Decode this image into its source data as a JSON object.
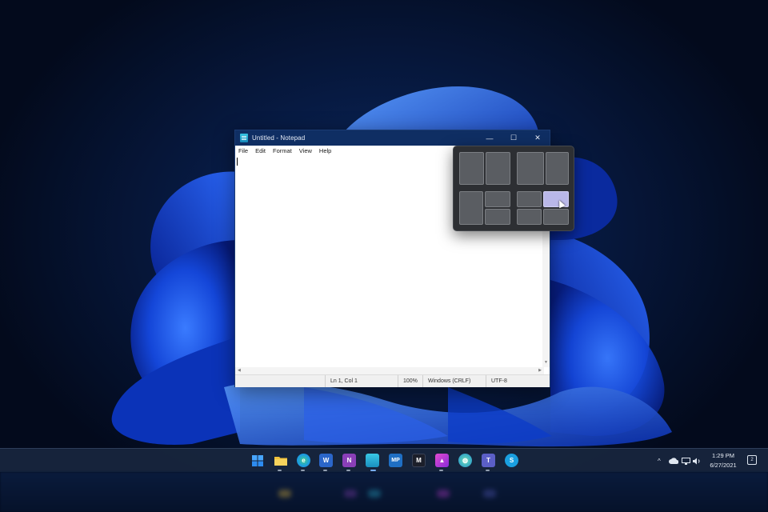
{
  "window": {
    "title": "Untitled - Notepad",
    "controls": {
      "minimize": "—",
      "maximize": "☐",
      "close": "✕"
    }
  },
  "menu": [
    "File",
    "Edit",
    "Format",
    "View",
    "Help"
  ],
  "editor": {
    "content": ""
  },
  "status": {
    "position": "Ln 1, Col 1",
    "zoom": "100%",
    "line_ending": "Windows (CRLF)",
    "encoding": "UTF-8"
  },
  "snap_layouts": {
    "layouts": [
      "two-column",
      "two-column-wide-left",
      "three-column",
      "grid-four"
    ],
    "highlighted_zone": "top-right of four-grid"
  },
  "taskbar": {
    "apps": [
      {
        "name": "Start",
        "icon": "windows-start-icon",
        "glyph": "⊞",
        "color": "#3aa0ff"
      },
      {
        "name": "File Explorer",
        "icon": "folder-icon",
        "glyph": "",
        "color": "#f2c23b"
      },
      {
        "name": "Microsoft Edge",
        "icon": "edge-icon",
        "glyph": "e",
        "color": "#1c9be0"
      },
      {
        "name": "Word",
        "icon": "word-icon",
        "glyph": "W",
        "color": "#2b66c9"
      },
      {
        "name": "OneNote",
        "icon": "onenote-icon",
        "glyph": "N",
        "color": "#8a3fb8"
      },
      {
        "name": "Notepad",
        "icon": "notepad-icon",
        "glyph": "",
        "color": "#2bb7d8"
      },
      {
        "name": "MP",
        "icon": "mp-icon",
        "glyph": "MP",
        "color": "#1f6fc4"
      },
      {
        "name": "Media",
        "icon": "media-icon",
        "glyph": "M",
        "color": "#1c1f2a"
      },
      {
        "name": "Affinity",
        "icon": "affinity-icon",
        "glyph": "▲",
        "color": "#c43ad6"
      },
      {
        "name": "Browser",
        "icon": "globe-icon",
        "glyph": "◍",
        "color": "#2aa67a"
      },
      {
        "name": "Teams",
        "icon": "teams-icon",
        "glyph": "T",
        "color": "#5b5fc7"
      },
      {
        "name": "Skype",
        "icon": "skype-icon",
        "glyph": "S",
        "color": "#1a9fe0"
      }
    ],
    "tray": {
      "chevron": "^",
      "time": "1:29 PM",
      "date": "6/27/2021",
      "notification_count": "2"
    }
  }
}
